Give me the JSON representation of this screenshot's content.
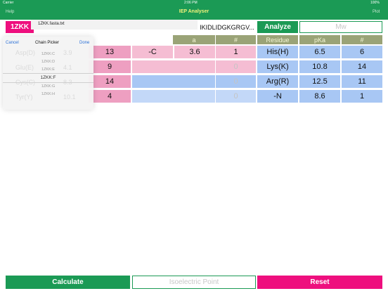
{
  "status": {
    "carrier": "Carrier",
    "time": "2:06 PM",
    "battery": "100%"
  },
  "nav": {
    "title": "IEP Analyser",
    "left": "Help",
    "right": "Plot"
  },
  "top": {
    "pdb": "1ZKK",
    "sequence": "IKIDLIDGKGRGV...",
    "analyze": "Analyze",
    "mw_placeholder": "Mw"
  },
  "file": {
    "name": "1ZKK.fasta.txt"
  },
  "picker": {
    "cancel": "Cancel",
    "title": "Chain Picker",
    "done": "Done",
    "items": [
      "1ZKK:C",
      "1ZKK:D",
      "1ZKK:E",
      "1ZKK:F",
      "1ZKK:G",
      "1ZKK:H"
    ],
    "selected": "1ZKK:F"
  },
  "left_table": {
    "headers": [
      "a",
      "#"
    ],
    "rows": [
      {
        "count": "13",
        "residue": "-C",
        "pka": "3.6",
        "num": "1"
      },
      {
        "count": "9",
        "residue": "",
        "pka": "",
        "num": "0"
      },
      {
        "count": "14",
        "residue": "",
        "pka": "",
        "num": "0"
      },
      {
        "count": "4",
        "residue": "",
        "pka": "",
        "num": "0"
      }
    ],
    "ghost_rows": [
      {
        "label": "Asp(D)",
        "value": "3.9"
      },
      {
        "label": "Glu(E)",
        "value": "4.1"
      },
      {
        "label": "Cys(C)",
        "value": "8.3"
      },
      {
        "label": "Tyr(Y)",
        "value": "10.1"
      }
    ]
  },
  "right_table": {
    "headers": [
      "Residue",
      "pKa",
      "#"
    ],
    "rows": [
      {
        "residue": "His(H)",
        "pka": "6.5",
        "num": "6"
      },
      {
        "residue": "Lys(K)",
        "pka": "10.8",
        "num": "14"
      },
      {
        "residue": "Arg(R)",
        "pka": "12.5",
        "num": "11"
      },
      {
        "residue": "-N",
        "pka": "8.6",
        "num": "1"
      }
    ]
  },
  "bottom": {
    "calculate": "Calculate",
    "iep_placeholder": "Isoelectric Point",
    "reset": "Reset"
  }
}
